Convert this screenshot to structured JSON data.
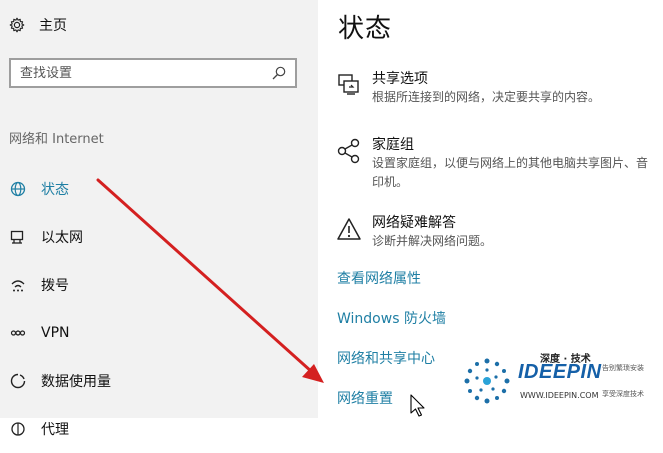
{
  "sidebar": {
    "home_label": "主页",
    "search_placeholder": "查找设置",
    "group_label": "网络和 Internet",
    "items": [
      {
        "label": "状态",
        "icon": "globe-icon",
        "active": true
      },
      {
        "label": "以太网",
        "icon": "ethernet-icon"
      },
      {
        "label": "拨号",
        "icon": "dialup-icon"
      },
      {
        "label": "VPN",
        "icon": "vpn-icon"
      },
      {
        "label": "数据使用量",
        "icon": "data-usage-icon"
      },
      {
        "label": "代理",
        "icon": "proxy-icon"
      }
    ]
  },
  "main": {
    "title": "状态",
    "options": [
      {
        "title": "共享选项",
        "desc": "根据所连接到的网络，决定要共享的内容。",
        "icon": "sharing-icon"
      },
      {
        "title": "家庭组",
        "desc": "设置家庭组，以便与网络上的其他电脑共享图片、音",
        "desc2": "印机。",
        "icon": "homegroup-icon"
      },
      {
        "title": "网络疑难解答",
        "desc": "诊断并解决网络问题。",
        "icon": "warning-icon"
      }
    ],
    "links": [
      "查看网络属性",
      "Windows 防火墙",
      "网络和共享中心",
      "网络重置"
    ]
  },
  "watermark": {
    "top": "深度 · 技术",
    "name": "IDEEPIN",
    "side1": "告别繁琐安装",
    "side2": "享受深度技术",
    "url": "WWW.IDEEPIN.COM"
  },
  "colors": {
    "accent": "#1f7fa4",
    "arrow": "#d42020",
    "sidebar_bg": "#f2f2f2"
  }
}
